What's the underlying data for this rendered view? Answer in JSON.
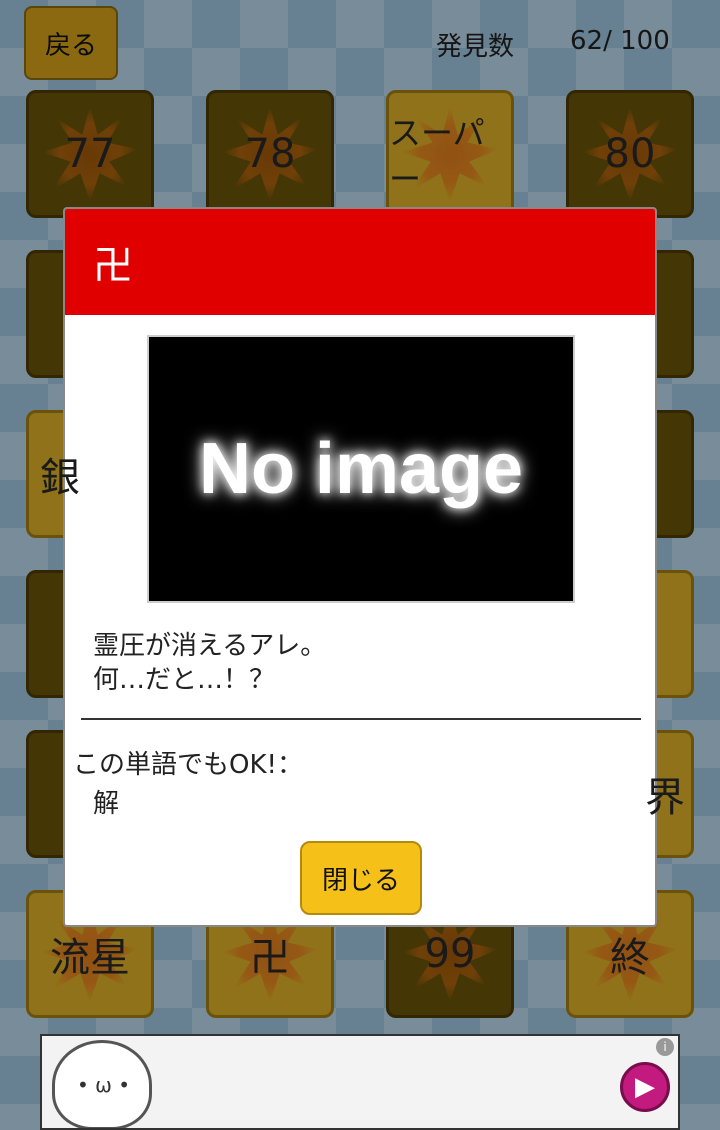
{
  "header": {
    "back_label": "戻る",
    "found_label": "発見数",
    "found_count": "62/ 100"
  },
  "grid": {
    "tiles": [
      {
        "label": "77",
        "state": "locked"
      },
      {
        "label": "78",
        "state": "locked"
      },
      {
        "label": "スーパー",
        "state": "found"
      },
      {
        "label": "80",
        "state": "locked"
      },
      {
        "label": "流星",
        "state": "found"
      },
      {
        "label": "卍",
        "state": "found"
      },
      {
        "label": "99",
        "state": "locked"
      },
      {
        "label": "終",
        "state": "found"
      }
    ],
    "partial_left": "銀",
    "partial_right": "界"
  },
  "dialog": {
    "title": "卍",
    "image_placeholder": "No image",
    "description_line1": "霊圧が消えるアレ。",
    "description_line2": "何…だと…！？",
    "alt_label": "この単語でもOK!：",
    "alt_word": "解",
    "close_label": "閉じる"
  },
  "ad": {
    "info": "i",
    "play": "▶",
    "cat_face": "• ω •"
  },
  "colors": {
    "header_red": "#e00000",
    "button_yellow": "#f5c018",
    "locked_tile": "#6b5308",
    "found_tile": "#ddb028"
  }
}
